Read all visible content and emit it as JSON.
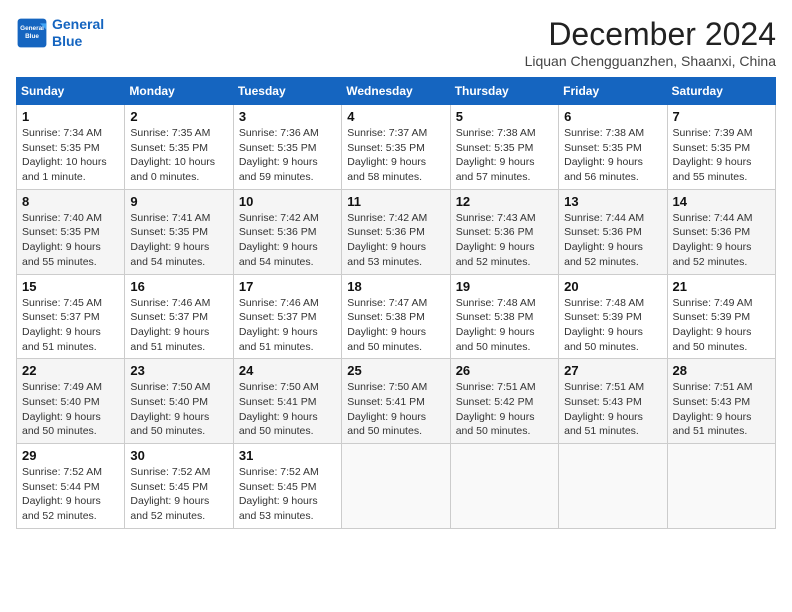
{
  "header": {
    "logo_line1": "General",
    "logo_line2": "Blue",
    "month_title": "December 2024",
    "location": "Liquan Chengguanzhen, Shaanxi, China"
  },
  "weekdays": [
    "Sunday",
    "Monday",
    "Tuesday",
    "Wednesday",
    "Thursday",
    "Friday",
    "Saturday"
  ],
  "weeks": [
    [
      {
        "day": "1",
        "info": "Sunrise: 7:34 AM\nSunset: 5:35 PM\nDaylight: 10 hours\nand 1 minute."
      },
      {
        "day": "2",
        "info": "Sunrise: 7:35 AM\nSunset: 5:35 PM\nDaylight: 10 hours\nand 0 minutes."
      },
      {
        "day": "3",
        "info": "Sunrise: 7:36 AM\nSunset: 5:35 PM\nDaylight: 9 hours\nand 59 minutes."
      },
      {
        "day": "4",
        "info": "Sunrise: 7:37 AM\nSunset: 5:35 PM\nDaylight: 9 hours\nand 58 minutes."
      },
      {
        "day": "5",
        "info": "Sunrise: 7:38 AM\nSunset: 5:35 PM\nDaylight: 9 hours\nand 57 minutes."
      },
      {
        "day": "6",
        "info": "Sunrise: 7:38 AM\nSunset: 5:35 PM\nDaylight: 9 hours\nand 56 minutes."
      },
      {
        "day": "7",
        "info": "Sunrise: 7:39 AM\nSunset: 5:35 PM\nDaylight: 9 hours\nand 55 minutes."
      }
    ],
    [
      {
        "day": "8",
        "info": "Sunrise: 7:40 AM\nSunset: 5:35 PM\nDaylight: 9 hours\nand 55 minutes."
      },
      {
        "day": "9",
        "info": "Sunrise: 7:41 AM\nSunset: 5:35 PM\nDaylight: 9 hours\nand 54 minutes."
      },
      {
        "day": "10",
        "info": "Sunrise: 7:42 AM\nSunset: 5:36 PM\nDaylight: 9 hours\nand 54 minutes."
      },
      {
        "day": "11",
        "info": "Sunrise: 7:42 AM\nSunset: 5:36 PM\nDaylight: 9 hours\nand 53 minutes."
      },
      {
        "day": "12",
        "info": "Sunrise: 7:43 AM\nSunset: 5:36 PM\nDaylight: 9 hours\nand 52 minutes."
      },
      {
        "day": "13",
        "info": "Sunrise: 7:44 AM\nSunset: 5:36 PM\nDaylight: 9 hours\nand 52 minutes."
      },
      {
        "day": "14",
        "info": "Sunrise: 7:44 AM\nSunset: 5:36 PM\nDaylight: 9 hours\nand 52 minutes."
      }
    ],
    [
      {
        "day": "15",
        "info": "Sunrise: 7:45 AM\nSunset: 5:37 PM\nDaylight: 9 hours\nand 51 minutes."
      },
      {
        "day": "16",
        "info": "Sunrise: 7:46 AM\nSunset: 5:37 PM\nDaylight: 9 hours\nand 51 minutes."
      },
      {
        "day": "17",
        "info": "Sunrise: 7:46 AM\nSunset: 5:37 PM\nDaylight: 9 hours\nand 51 minutes."
      },
      {
        "day": "18",
        "info": "Sunrise: 7:47 AM\nSunset: 5:38 PM\nDaylight: 9 hours\nand 50 minutes."
      },
      {
        "day": "19",
        "info": "Sunrise: 7:48 AM\nSunset: 5:38 PM\nDaylight: 9 hours\nand 50 minutes."
      },
      {
        "day": "20",
        "info": "Sunrise: 7:48 AM\nSunset: 5:39 PM\nDaylight: 9 hours\nand 50 minutes."
      },
      {
        "day": "21",
        "info": "Sunrise: 7:49 AM\nSunset: 5:39 PM\nDaylight: 9 hours\nand 50 minutes."
      }
    ],
    [
      {
        "day": "22",
        "info": "Sunrise: 7:49 AM\nSunset: 5:40 PM\nDaylight: 9 hours\nand 50 minutes."
      },
      {
        "day": "23",
        "info": "Sunrise: 7:50 AM\nSunset: 5:40 PM\nDaylight: 9 hours\nand 50 minutes."
      },
      {
        "day": "24",
        "info": "Sunrise: 7:50 AM\nSunset: 5:41 PM\nDaylight: 9 hours\nand 50 minutes."
      },
      {
        "day": "25",
        "info": "Sunrise: 7:50 AM\nSunset: 5:41 PM\nDaylight: 9 hours\nand 50 minutes."
      },
      {
        "day": "26",
        "info": "Sunrise: 7:51 AM\nSunset: 5:42 PM\nDaylight: 9 hours\nand 50 minutes."
      },
      {
        "day": "27",
        "info": "Sunrise: 7:51 AM\nSunset: 5:43 PM\nDaylight: 9 hours\nand 51 minutes."
      },
      {
        "day": "28",
        "info": "Sunrise: 7:51 AM\nSunset: 5:43 PM\nDaylight: 9 hours\nand 51 minutes."
      }
    ],
    [
      {
        "day": "29",
        "info": "Sunrise: 7:52 AM\nSunset: 5:44 PM\nDaylight: 9 hours\nand 52 minutes."
      },
      {
        "day": "30",
        "info": "Sunrise: 7:52 AM\nSunset: 5:45 PM\nDaylight: 9 hours\nand 52 minutes."
      },
      {
        "day": "31",
        "info": "Sunrise: 7:52 AM\nSunset: 5:45 PM\nDaylight: 9 hours\nand 53 minutes."
      },
      {
        "day": "",
        "info": ""
      },
      {
        "day": "",
        "info": ""
      },
      {
        "day": "",
        "info": ""
      },
      {
        "day": "",
        "info": ""
      }
    ]
  ]
}
